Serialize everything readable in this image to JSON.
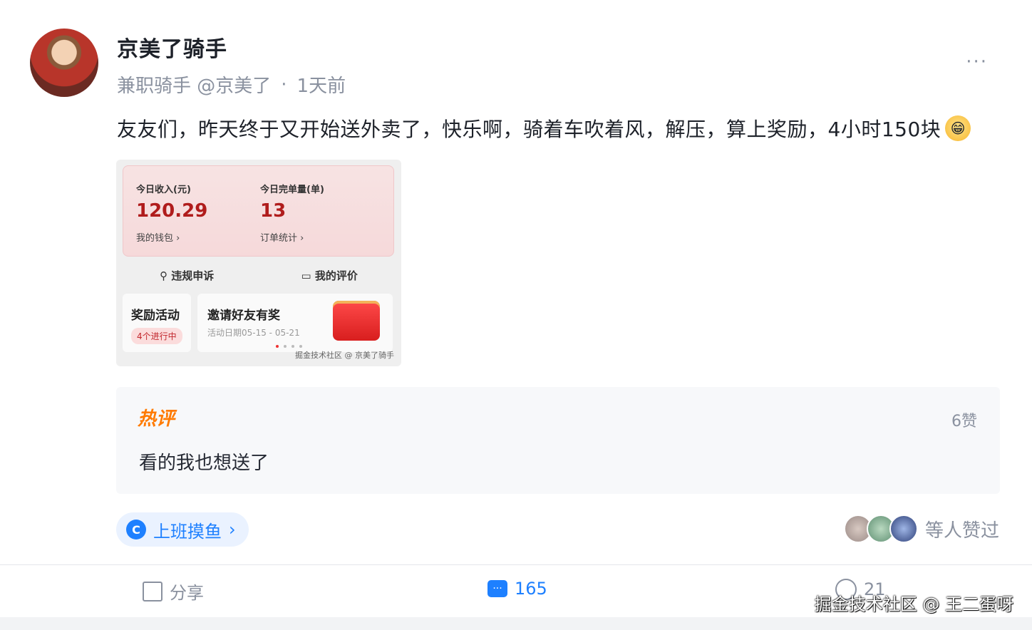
{
  "post": {
    "author": "京美了骑手",
    "role": "兼职骑手 @京美了",
    "separator": "·",
    "time": "1天前",
    "more": "···",
    "content": "友友们，昨天终于又开始送外卖了，快乐啊，骑着车吹着风，解压，算上奖励，4小时150块",
    "emoji": "😁"
  },
  "screenshot": {
    "income_label": "今日收入(元)",
    "income_value": "120.29",
    "wallet": "我的钱包 ›",
    "orders_label": "今日完单量(单)",
    "orders_value": "13",
    "order_stats": "订单统计 ›",
    "appeal": "违规申诉",
    "my_rating": "我的评价",
    "rewards": "奖励活动",
    "rewards_badge": "4个进行中",
    "invite": "邀请好友有奖",
    "invite_date": "活动日期05-15 - 05-21",
    "watermark": "掘金技术社区 @ 京美了骑手"
  },
  "hot_comment": {
    "badge": "热评",
    "likes": "6赞",
    "text": "看的我也想送了"
  },
  "topic": {
    "icon": "C",
    "label": "上班摸鱼",
    "chevron": "›"
  },
  "likers": {
    "text": "等人赞过"
  },
  "actions": {
    "share": "分享",
    "comments": "165",
    "likes": "21"
  },
  "watermark": "掘金技术社区 @ 王二蛋呀",
  "colors": {
    "accent": "#1e80ff",
    "hot": "#ff7a00",
    "income": "#b01c1c"
  }
}
